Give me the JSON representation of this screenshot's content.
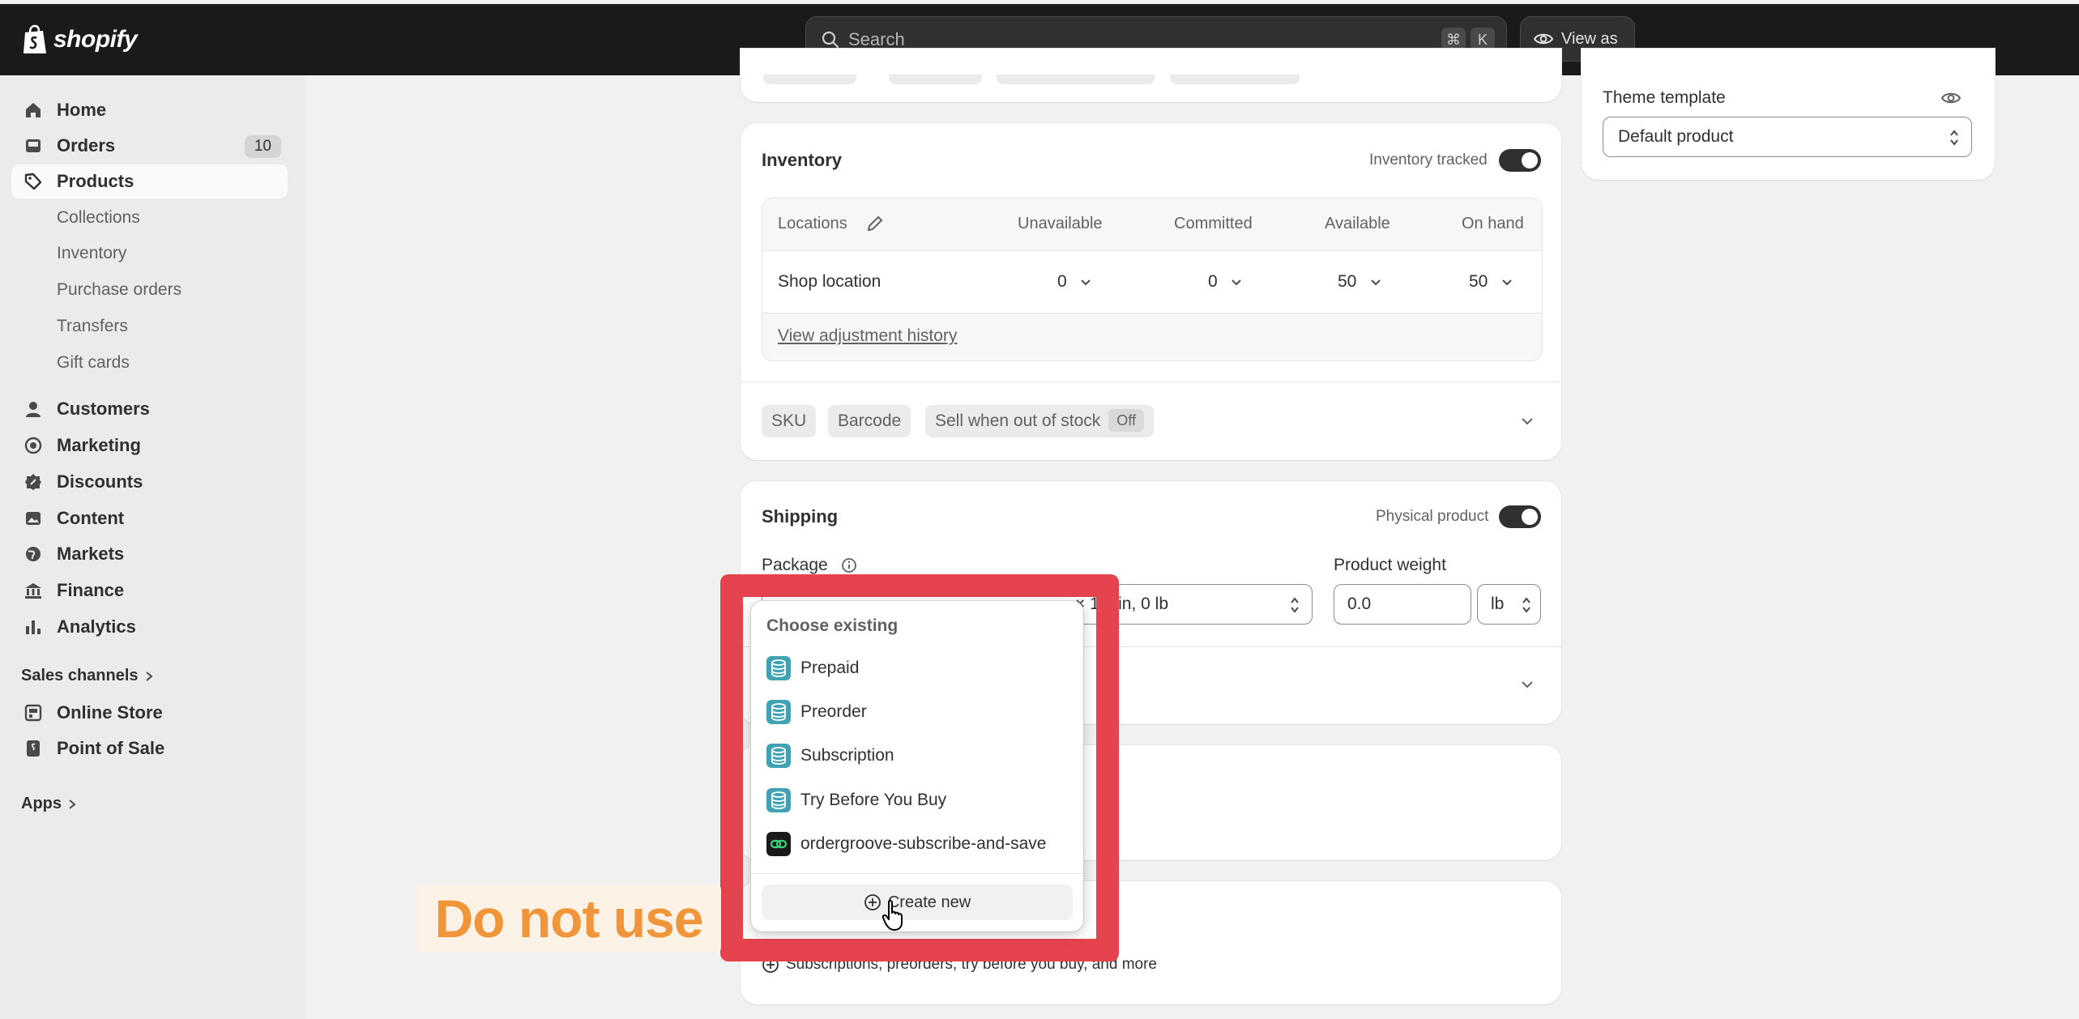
{
  "topbar": {
    "logo_text": "shopify",
    "search_placeholder": "Search",
    "shortcut_key1": "⌘",
    "shortcut_key2": "K",
    "view_as": "View as"
  },
  "sidebar": {
    "home": "Home",
    "orders": "Orders",
    "orders_count": "10",
    "products": "Products",
    "products_sub": [
      "Collections",
      "Inventory",
      "Purchase orders",
      "Transfers",
      "Gift cards"
    ],
    "customers": "Customers",
    "marketing": "Marketing",
    "discounts": "Discounts",
    "content": "Content",
    "markets": "Markets",
    "finance": "Finance",
    "analytics": "Analytics",
    "sales_channels": "Sales channels",
    "online_store": "Online Store",
    "point_of_sale": "Point of Sale",
    "apps": "Apps"
  },
  "inventory": {
    "title": "Inventory",
    "tracked_label": "Inventory tracked",
    "headers": {
      "locations": "Locations",
      "unavailable": "Unavailable",
      "committed": "Committed",
      "available": "Available",
      "on_hand": "On hand"
    },
    "row": {
      "location": "Shop location",
      "unavailable": "0",
      "committed": "0",
      "available": "50",
      "on_hand": "50"
    },
    "history_link": "View adjustment history",
    "sku": "SKU",
    "barcode": "Barcode",
    "sell_oos": "Sell when out of stock",
    "sell_oos_state": "Off"
  },
  "shipping": {
    "title": "Shipping",
    "physical_label": "Physical product",
    "package_label": "Package",
    "package_value_partial": "× 1.6 in, 0 lb",
    "weight_label": "Product weight",
    "weight_value": "0.0",
    "weight_unit": "lb"
  },
  "theme": {
    "label": "Theme template",
    "value": "Default product"
  },
  "purchase_options": {
    "add_link": "Subscriptions, preorders, try before you buy, and more"
  },
  "popover": {
    "header": "Choose existing",
    "items": [
      {
        "label": "Prepaid",
        "icon": "database-icon"
      },
      {
        "label": "Preorder",
        "icon": "database-icon"
      },
      {
        "label": "Subscription",
        "icon": "database-icon"
      },
      {
        "label": "Try Before You Buy",
        "icon": "database-icon"
      },
      {
        "label": "ordergroove-subscribe-and-save",
        "icon": "link-icon"
      }
    ],
    "create_new": "Create new"
  },
  "annotation": {
    "text": "Do not use"
  },
  "colors": {
    "topbar": "#1a1a1a",
    "annotation_red": "#e5444f",
    "annotation_orange": "#f0953a",
    "app_icon_teal": "#3fa3b5"
  }
}
